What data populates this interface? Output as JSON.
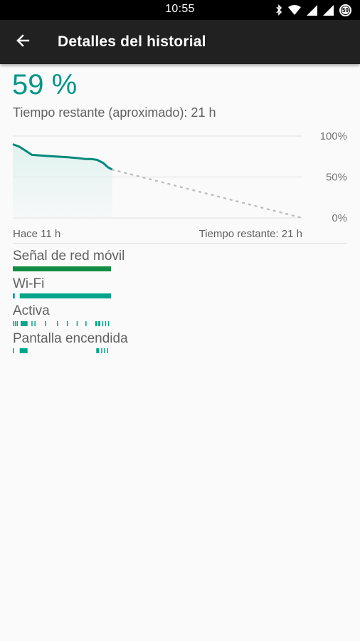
{
  "status_bar": {
    "time": "10:55",
    "battery_level": "59",
    "icons": [
      "bluetooth-icon",
      "wifi-icon",
      "signal-icon",
      "signal-icon",
      "battery-icon"
    ]
  },
  "app_bar": {
    "title": "Detalles del historial",
    "back_icon": "arrow-left-icon"
  },
  "battery": {
    "percent_text": "59 %",
    "remaining_text": "Tiempo restante (aproximado): 21 h"
  },
  "chart_data": {
    "type": "line",
    "y_tick_labels": [
      "100%",
      "50%",
      "0%"
    ],
    "ylim": [
      0,
      100
    ],
    "x_start_label": "Hace 11 h",
    "x_end_label": "Tiempo restante: 21 h",
    "history": {
      "hours": [
        -11,
        -10.3,
        -9.7,
        -8.9,
        -7.6,
        -6.2,
        -4.8,
        -3.7,
        -3.0,
        -2.4,
        -1.7,
        -1.0,
        -0.5,
        0
      ],
      "battery_pct": [
        90,
        87,
        83,
        77,
        76,
        75,
        74,
        73,
        72,
        72,
        71,
        67,
        62,
        59
      ]
    },
    "projection": {
      "hours": [
        0,
        21
      ],
      "battery_pct": [
        59,
        0
      ]
    },
    "colors": {
      "line": "#00897b",
      "fill": "#e0f2ef",
      "projection": "#bdbdbd",
      "grid": "#e0e0e0"
    }
  },
  "usage": [
    {
      "label": "Señal de red móvil",
      "color": "#138d44",
      "segments": [
        [
          0,
          1
        ]
      ]
    },
    {
      "label": "Wi-Fi",
      "color": "#00a58a",
      "segments": [
        [
          0,
          0.02
        ],
        [
          0.07,
          1
        ]
      ]
    },
    {
      "label": "Activa",
      "color": "#00a58a",
      "segments": [
        [
          0,
          0.01
        ],
        [
          0.02,
          0.03
        ],
        [
          0.04,
          0.05
        ],
        [
          0.08,
          0.15
        ],
        [
          0.19,
          0.2
        ],
        [
          0.22,
          0.23
        ],
        [
          0.33,
          0.34
        ],
        [
          0.45,
          0.46
        ],
        [
          0.55,
          0.56
        ],
        [
          0.65,
          0.66
        ],
        [
          0.74,
          0.75
        ],
        [
          0.84,
          0.86
        ],
        [
          0.87,
          0.89
        ],
        [
          0.91,
          0.92
        ],
        [
          0.94,
          0.95
        ],
        [
          0.97,
          0.98
        ]
      ]
    },
    {
      "label": "Pantalla encendida",
      "color": "#00a58a",
      "segments": [
        [
          0,
          0.01
        ],
        [
          0.07,
          0.15
        ],
        [
          0.85,
          0.88
        ],
        [
          0.9,
          0.91
        ],
        [
          0.93,
          0.94
        ],
        [
          0.96,
          0.97
        ]
      ]
    }
  ]
}
